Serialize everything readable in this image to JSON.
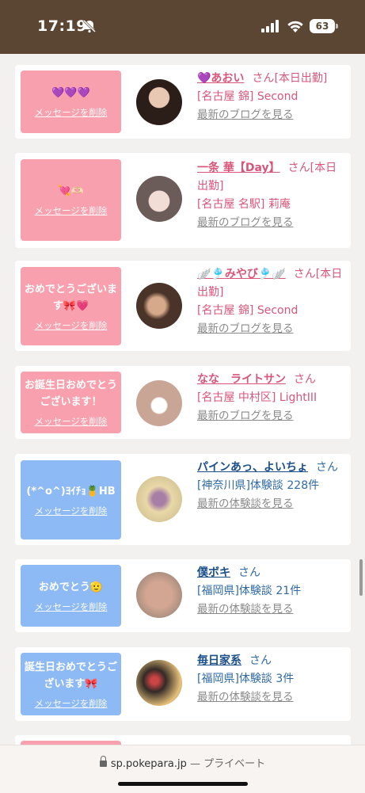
{
  "status_bar": {
    "time": "17:19",
    "battery": "63"
  },
  "delete_label": "メッセージを削除",
  "san_label": "さん",
  "cards": [
    {
      "message": "💜💜💜",
      "name": "💜あおい",
      "line1": "[本日出勤]",
      "line2": "[名古屋 錦] Second",
      "link": "最新のブログを見る"
    },
    {
      "message": "💘🫶🏻",
      "name": "一条 華【Day】",
      "line1": "[本日出勤]",
      "line2": "[名古屋 名駅] 莉庵",
      "link": "最新のブログを見る"
    },
    {
      "message": "おめでとうございます🎀💗",
      "name": "🪽🎐みやび🎐🪽",
      "line1": "[本日出勤]",
      "line2": "[名古屋 錦] Second",
      "link": "最新のブログを見る"
    },
    {
      "message": "お誕生日おめでとうございます！",
      "name": "なな　ライトサン",
      "line1": "",
      "line2": "[名古屋 中村区] LightIII",
      "link": "最新のブログを見る"
    },
    {
      "message": "(*^o^)ﾖｲﾁｮ🍍HB",
      "name": "パインあっ、よいちょ",
      "line1": "",
      "line2": "[神奈川県]体験談 228件",
      "link": "最新の体験談を見る"
    },
    {
      "message": "おめでとう🫡",
      "name": "僕ボキ",
      "line1": "",
      "line2": "[福岡県]体験談 21件",
      "link": "最新の体験談を見る"
    },
    {
      "message": "誕生日おめでとうございます🎀",
      "name": "毎日家系",
      "line1": "",
      "line2": "[福岡県]体験談 3件",
      "link": "最新の体験談を見る"
    }
  ],
  "browser": {
    "url": "sp.pokepara.jp",
    "mode": "— プライベート"
  },
  "colors": {
    "header": "#5b4634",
    "pink": "#f8a0ae",
    "blue": "#8db9f4"
  }
}
